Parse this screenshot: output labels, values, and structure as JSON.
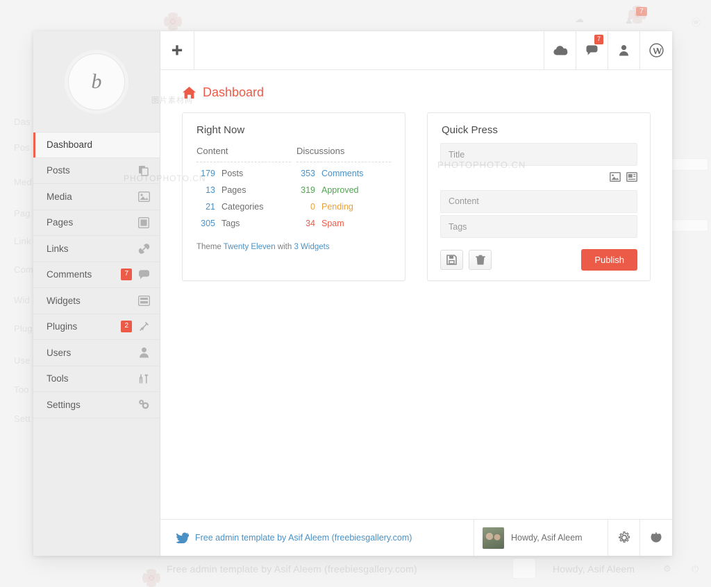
{
  "window": {
    "topbar": {
      "plus_icon": "plus-icon",
      "buttons": [
        {
          "name": "cloud-button",
          "icon": "cloud-icon",
          "badge": ""
        },
        {
          "name": "comments-button",
          "icon": "comment-icon",
          "badge": "7"
        },
        {
          "name": "user-button",
          "icon": "user-icon",
          "badge": ""
        },
        {
          "name": "wordpress-button",
          "icon": "wordpress-icon",
          "badge": ""
        }
      ]
    },
    "page": {
      "title": "Dashboard",
      "icon": "home-icon"
    }
  },
  "sidebar": {
    "logo_mark": "b",
    "items": [
      {
        "label": "Dashboard",
        "icon": "",
        "badge": "",
        "active": true
      },
      {
        "label": "Posts",
        "icon": "posts-icon",
        "badge": ""
      },
      {
        "label": "Media",
        "icon": "media-icon",
        "badge": ""
      },
      {
        "label": "Pages",
        "icon": "pages-icon",
        "badge": ""
      },
      {
        "label": "Links",
        "icon": "link-icon",
        "badge": ""
      },
      {
        "label": "Comments",
        "icon": "comment-icon",
        "badge": "7"
      },
      {
        "label": "Widgets",
        "icon": "widgets-icon",
        "badge": ""
      },
      {
        "label": "Plugins",
        "icon": "plugin-icon",
        "badge": "2"
      },
      {
        "label": "Users",
        "icon": "user-icon",
        "badge": ""
      },
      {
        "label": "Tools",
        "icon": "tools-icon",
        "badge": ""
      },
      {
        "label": "Settings",
        "icon": "gear-icon",
        "badge": ""
      }
    ]
  },
  "right_now": {
    "title": "Right Now",
    "content_header": "Content",
    "discussions_header": "Discussions",
    "content_rows": [
      {
        "count": "179",
        "label": "Posts"
      },
      {
        "count": "13",
        "label": "Pages"
      },
      {
        "count": "21",
        "label": "Categories"
      },
      {
        "count": "305",
        "label": "Tags"
      }
    ],
    "discussion_rows": [
      {
        "count": "353",
        "label": "Comments",
        "style": "link"
      },
      {
        "count": "319",
        "label": "Approved",
        "style": "approved"
      },
      {
        "count": "0",
        "label": "Pending",
        "style": "pending"
      },
      {
        "count": "34",
        "label": "Spam",
        "style": "spam"
      }
    ],
    "footer": {
      "prefix": "Theme",
      "theme_name": "Twenty Eleven",
      "middle": "with",
      "widgets_link": "3 Widgets"
    }
  },
  "quick_press": {
    "title": "Quick Press",
    "title_placeholder": "Title",
    "content_placeholder": "Content",
    "tags_placeholder": "Tags",
    "media_icons": [
      "image-icon",
      "video-icon"
    ],
    "save_icon": "save-icon",
    "trash_icon": "trash-icon",
    "publish_label": "Publish"
  },
  "footer": {
    "credit_icon": "twitter-icon",
    "credit_text": "Free admin template by Asif Aleem (freebiesgallery.com)",
    "greeting": "Howdy, Asif Aleem",
    "settings_icon": "gear-icon",
    "power_icon": "power-icon"
  },
  "background_ghost": {
    "nav_labels": [
      "Das",
      "Pos",
      "Med",
      "Pag",
      "Link",
      "Com",
      "Wid",
      "Plug",
      "Use",
      "Too",
      "Sett"
    ],
    "footer_text": "Free admin template by Asif Aleem (freebiesgallery.com)",
    "greeting": "Howdy, Asif Aleem",
    "badge": "7"
  },
  "watermarks": [
    "PHOTOPHOTO.CN",
    "图片素材网"
  ],
  "colors": {
    "accent": "#ec5b48",
    "link": "#4a90c4",
    "approved": "#54a254",
    "pending": "#e8a33d",
    "spam": "#ec5b48",
    "sidebar_bg": "#ededed"
  }
}
